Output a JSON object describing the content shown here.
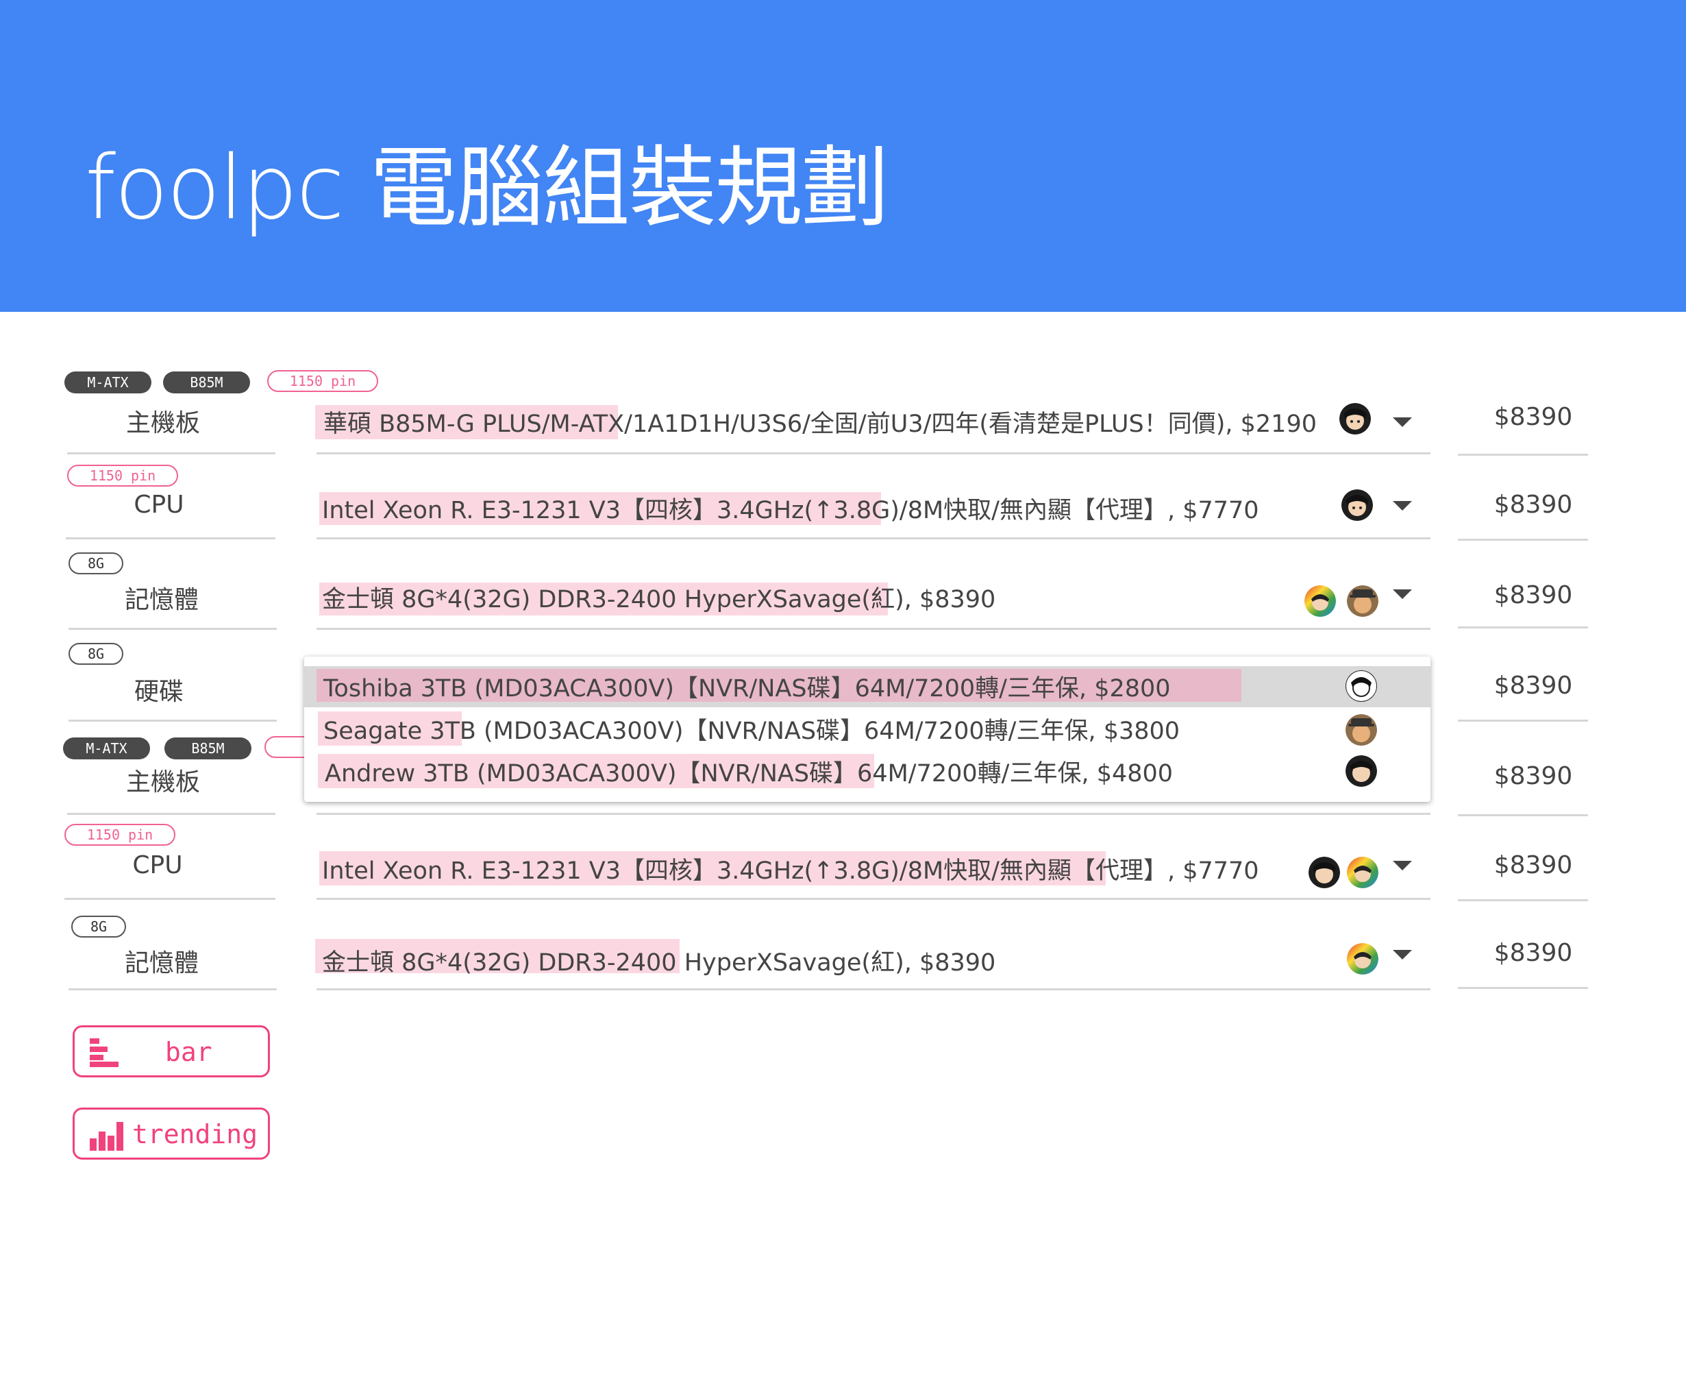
{
  "header": {
    "title": "foolpc 電腦組裝規劃"
  },
  "rows": [
    {
      "tags": [
        "M-ATX",
        "B85M",
        "1150 pin"
      ],
      "label": "主機板",
      "item": "華碩 B85M-G PLUS/M-ATX/1A1D1H/U3S6/全固/前U3/四年(看清楚是PLUS！同價), $2190",
      "price": "$8390"
    },
    {
      "tags": [
        "1150 pin"
      ],
      "label": "CPU",
      "item": "Intel Xeon R. E3-1231 V3【四核】3.4GHz(↑3.8G)/8M快取/無內顯【代理】, $7770",
      "price": "$8390"
    },
    {
      "tags": [
        "8G"
      ],
      "label": "記憶體",
      "item": "金士頓 8G*4(32G) DDR3-2400 HyperXSavage(紅), $8390",
      "price": "$8390"
    },
    {
      "tags": [
        "8G"
      ],
      "label": "硬碟",
      "item": "",
      "price": "$8390"
    },
    {
      "tags": [
        "M-ATX",
        "B85M"
      ],
      "label": "主機板",
      "item": "",
      "price": "$8390"
    },
    {
      "tags": [
        "1150 pin"
      ],
      "label": "CPU",
      "item": "Intel Xeon R. E3-1231 V3【四核】3.4GHz(↑3.8G)/8M快取/無內顯【代理】, $7770",
      "price": "$8390"
    },
    {
      "tags": [
        "8G"
      ],
      "label": "記憶體",
      "item": "金士頓 8G*4(32G) DDR3-2400 HyperXSavage(紅), $8390",
      "price": "$8390"
    }
  ],
  "dropdown": {
    "options": [
      "Toshiba 3TB (MD03ACA300V)【NVR/NAS碟】64M/7200轉/三年保, $2800",
      "Seagate 3TB (MD03ACA300V)【NVR/NAS碟】64M/7200轉/三年保, $3800",
      "Andrew 3TB (MD03ACA300V)【NVR/NAS碟】64M/7200轉/三年保, $4800"
    ],
    "selected_index": 0
  },
  "buttons": {
    "bar": "bar",
    "trending": "trending"
  },
  "icons": {
    "avatar": "avatar-icon",
    "caret": "caret-down-icon",
    "bar": "bar-chart-horizontal-icon",
    "trending": "bar-chart-vertical-icon"
  },
  "colors": {
    "header": "#4285f4",
    "accent": "#f0437d",
    "highlight": "#fbd7e1",
    "tag_dark": "#4a4a4a"
  }
}
